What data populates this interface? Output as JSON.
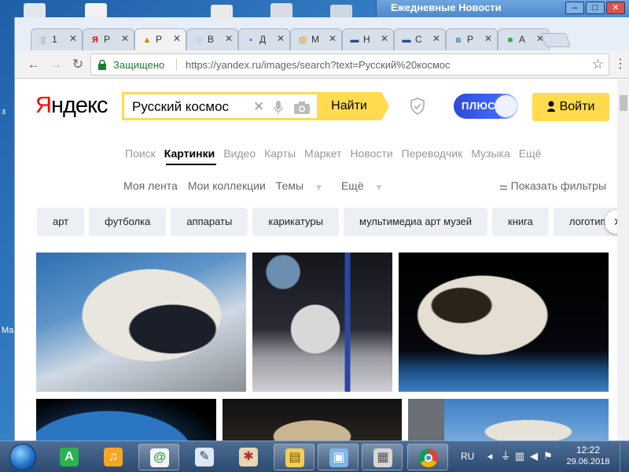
{
  "desktop": {
    "edge_labels": [
      "Ма",
      "з"
    ]
  },
  "background_window": {
    "title": "Ежедневные Новости",
    "minimize": "–",
    "maximize": "□",
    "close": "✕"
  },
  "tabs": [
    {
      "favicon": "page-icon",
      "glyph": "▯",
      "label": "1",
      "color": "#888888"
    },
    {
      "favicon": "yandex-icon",
      "glyph": "Я",
      "label": "Р",
      "color": "#ff0000"
    },
    {
      "favicon": "images-icon",
      "glyph": "▲",
      "label": "Р",
      "color": "#d18a00",
      "active": true
    },
    {
      "favicon": "loading-icon",
      "glyph": "◌",
      "label": "В",
      "color": "#2a7be4"
    },
    {
      "favicon": "chat-icon",
      "glyph": "▪",
      "label": "Д",
      "color": "#2a7be4"
    },
    {
      "favicon": "mail-icon",
      "glyph": "@",
      "label": "М",
      "color": "#e8a000"
    },
    {
      "favicon": "news-icon",
      "glyph": "▬",
      "label": "Н",
      "color": "#1d4e89"
    },
    {
      "favicon": "news-icon",
      "glyph": "▬",
      "label": "С",
      "color": "#1d4e89"
    },
    {
      "favicon": "vk-icon",
      "glyph": "в",
      "label": "Р",
      "color": "#4a76a8"
    },
    {
      "favicon": "app-icon",
      "glyph": "■",
      "label": "А",
      "color": "#3aa655"
    }
  ],
  "tab_close": "✕",
  "toolbar": {
    "back": "←",
    "forward": "→",
    "reload": "↻",
    "secure_label": "Защищено",
    "url": "https://yandex.ru/images/search?text=Русский%20космос",
    "star": "☆",
    "menu": "⋮"
  },
  "header": {
    "logo_first": "Я",
    "logo_rest": "ндекс",
    "search_value": "Русский космос",
    "clear": "✕",
    "find_label": "Найти",
    "plus_label": "ПЛЮС",
    "login_label": "Войти"
  },
  "services": [
    "Поиск",
    "Картинки",
    "Видео",
    "Карты",
    "Маркет",
    "Новости",
    "Переводчик",
    "Музыка",
    "Ещё"
  ],
  "subnav": {
    "feed": "Моя лента",
    "collections": "Мои коллекции",
    "themes": "Темы",
    "more": "Ещё",
    "filters": "Показать фильтры"
  },
  "chips": [
    "арт",
    "футболка",
    "аппараты",
    "карикатуры",
    "мультимедиа арт музей",
    "книга",
    "логотип"
  ],
  "chip_next": "›",
  "images": [
    {
      "name": "cosmonaut-closeup"
    },
    {
      "name": "cosmonaut-with-flag"
    },
    {
      "name": "cosmonaut-spacewalk"
    },
    {
      "name": "earth-orbit"
    },
    {
      "name": "cosmonaut-helmet"
    },
    {
      "name": "station-spacewalk"
    }
  ],
  "taskbar": {
    "lang": "RU",
    "time": "12:22",
    "date": "29.06.2018"
  }
}
